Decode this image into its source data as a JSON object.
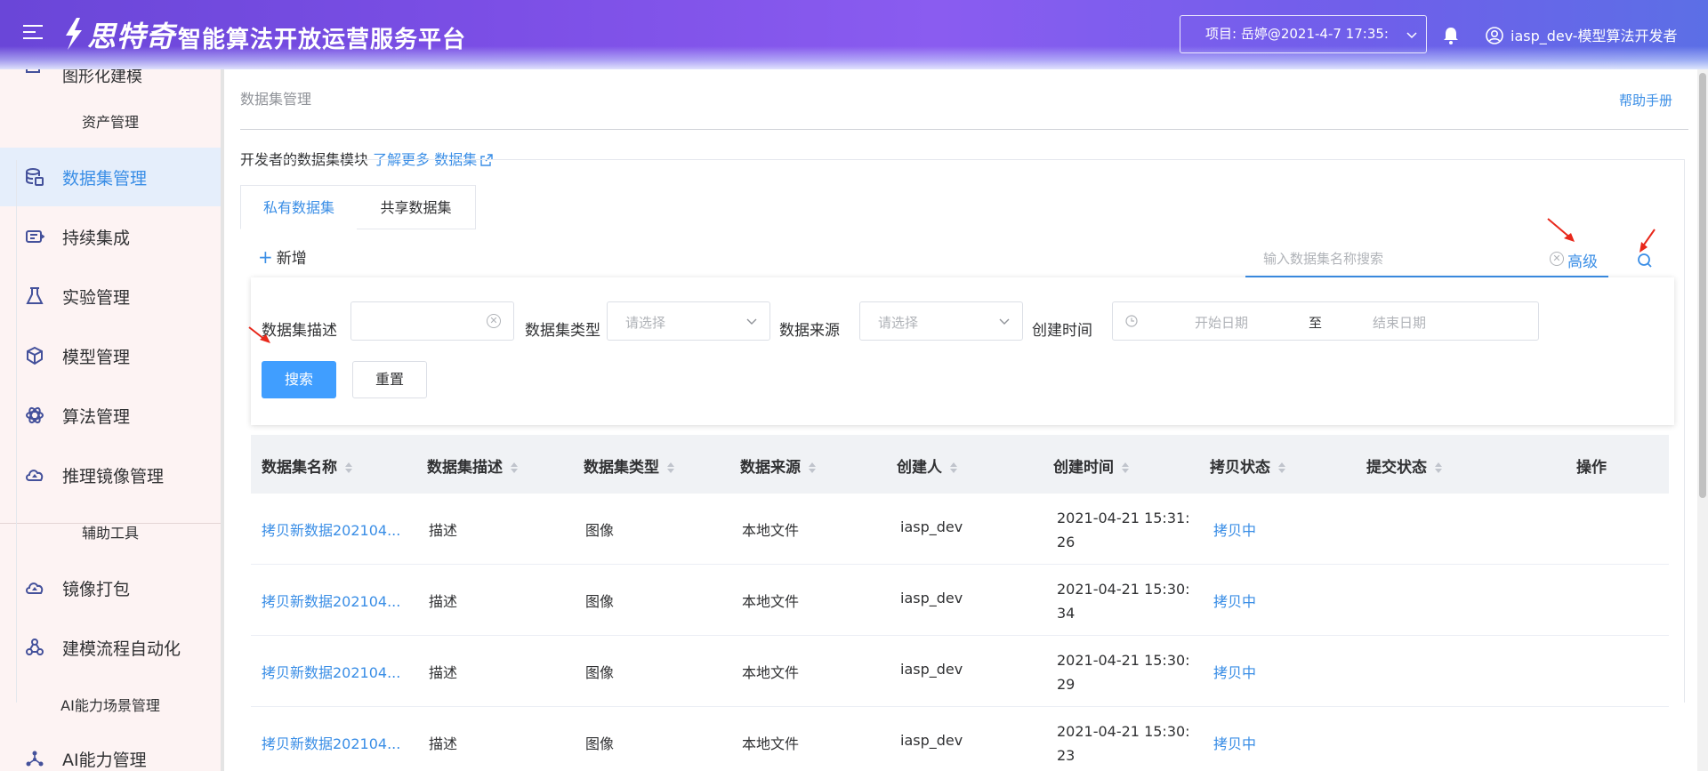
{
  "header": {
    "logo_text": "思特奇",
    "platform_title": "智能算法开放运营服务平台",
    "project": "项目: 岳婷@2021-4-7 17:35:",
    "user": "iasp_dev-模型算法开发者",
    "bg_color": "#7b52e6"
  },
  "sidebar": {
    "cut_item": "图形化建模",
    "group_assets": "资产管理",
    "group_tools": "辅助工具",
    "group_ai": "AI能力场景管理",
    "items": [
      {
        "label": "数据集管理",
        "icon": "database-icon",
        "active": true
      },
      {
        "label": "持续集成",
        "icon": "pipeline-icon"
      },
      {
        "label": "实验管理",
        "icon": "flask-icon"
      },
      {
        "label": "模型管理",
        "icon": "cube-icon"
      },
      {
        "label": "算法管理",
        "icon": "atom-icon"
      },
      {
        "label": "推理镜像管理",
        "icon": "cloud-icon"
      },
      {
        "label": "镜像打包",
        "icon": "cloud-package-icon"
      },
      {
        "label": "建模流程自动化",
        "icon": "flow-icon"
      },
      {
        "label": "AI能力管理",
        "icon": "network-icon"
      }
    ]
  },
  "main": {
    "breadcrumb": "数据集管理",
    "help": "帮助手册",
    "intro_text": "开发者的数据集模块",
    "intro_link": "了解更多 数据集",
    "tabs": [
      "私有数据集",
      "共享数据集"
    ],
    "add_label": "新增",
    "search_placeholder": "输入数据集名称搜索",
    "advanced_label": "高级",
    "filters": {
      "desc_label": "数据集描述",
      "type_label": "数据集类型",
      "type_placeholder": "请选择",
      "source_label": "数据来源",
      "source_placeholder": "请选择",
      "time_label": "创建时间",
      "start_placeholder": "开始日期",
      "range_sep": "至",
      "end_placeholder": "结束日期",
      "search_btn": "搜索",
      "reset_btn": "重置"
    },
    "table": {
      "columns": [
        "数据集名称",
        "数据集描述",
        "数据集类型",
        "数据来源",
        "创建人",
        "创建时间",
        "拷贝状态",
        "提交状态",
        "操作"
      ],
      "rows": [
        {
          "name": "拷贝新数据202104...",
          "desc": "描述",
          "type": "图像",
          "source": "本地文件",
          "creator": "iasp_dev",
          "time": "2021-04-21 15:31:26",
          "copy": "拷贝中",
          "submit": ""
        },
        {
          "name": "拷贝新数据202104...",
          "desc": "描述",
          "type": "图像",
          "source": "本地文件",
          "creator": "iasp_dev",
          "time": "2021-04-21 15:30:34",
          "copy": "拷贝中",
          "submit": ""
        },
        {
          "name": "拷贝新数据202104...",
          "desc": "描述",
          "type": "图像",
          "source": "本地文件",
          "creator": "iasp_dev",
          "time": "2021-04-21 15:30:29",
          "copy": "拷贝中",
          "submit": ""
        },
        {
          "name": "拷贝新数据202104...",
          "desc": "描述",
          "type": "图像",
          "source": "本地文件",
          "creator": "iasp_dev",
          "time": "2021-04-21 15:30:23",
          "copy": "拷贝中",
          "submit": ""
        }
      ]
    }
  },
  "colors": {
    "accent": "#3a8ee6",
    "primary_button": "#409eff",
    "annotation_arrow": "#e8281b"
  }
}
